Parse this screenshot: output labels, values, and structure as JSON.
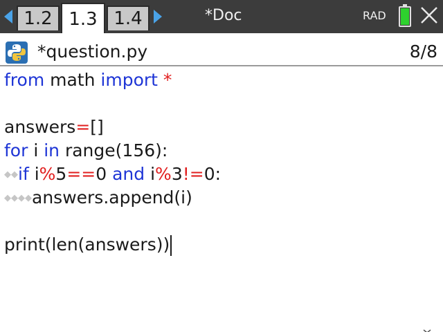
{
  "topbar": {
    "tabs": [
      {
        "label": "1.2",
        "active": false
      },
      {
        "label": "1.3",
        "active": true
      },
      {
        "label": "1.4",
        "active": false
      }
    ],
    "doc_title": "*Doc",
    "angle_mode": "RAD",
    "battery_color": "#2ed12e",
    "icons": [
      "chevron-left-icon",
      "chevron-right-icon",
      "battery-icon",
      "close-icon"
    ]
  },
  "editor": {
    "file_name": "*question.py",
    "line_counter": "8/8",
    "file_icon": "python-icon",
    "code": {
      "line1": {
        "t1": "from",
        "t2": " math ",
        "t3": "import",
        "t4": " ",
        "t5": "*"
      },
      "line3": {
        "t1": "answers",
        "t2": "=",
        "t3": "[]"
      },
      "line4": {
        "t1": "for",
        "t2": " i ",
        "t3": "in",
        "t4": " range(156):"
      },
      "line5": {
        "indent": "◆◆",
        "t1": "if",
        "t2": " i",
        "t3": "%",
        "t4": "5",
        "t5": "==",
        "t6": "0 ",
        "t7": "and",
        "t8": " i",
        "t9": "%",
        "t10": "3",
        "t11": "!=",
        "t12": "0:"
      },
      "line6": {
        "indent": "◆◆◆◆",
        "t1": "answers.append(i)"
      },
      "line8": {
        "t1": "print(len(answers))"
      }
    },
    "colors": {
      "keyword": "#1e35d6",
      "operator": "#e11f1f",
      "text": "#1a1a1a"
    }
  }
}
